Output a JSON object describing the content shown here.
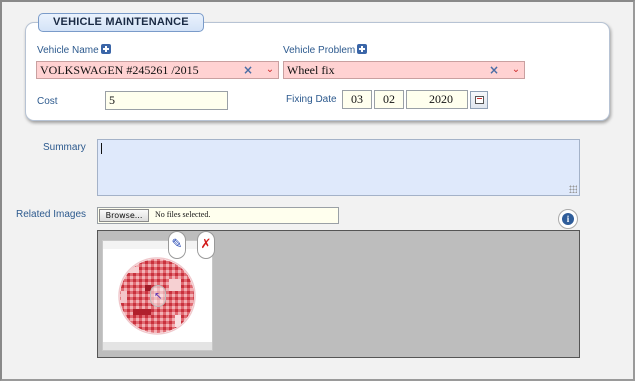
{
  "form": {
    "legend": "VEHICLE MAINTENANCE",
    "vehicle_name_label": "Vehicle Name",
    "vehicle_name_value": "VOLKSWAGEN #245261 /2015",
    "vehicle_problem_label": "Vehicle Problem",
    "vehicle_problem_value": "Wheel fix",
    "cost_label": "Cost",
    "cost_value": "5",
    "fixing_date_label": "Fixing Date",
    "fixing_date_day": "03",
    "fixing_date_month": "02",
    "fixing_date_year": "2020"
  },
  "summary": {
    "label": "Summary",
    "value": ""
  },
  "related_images": {
    "label": "Related Images",
    "browse_label": "Browse...",
    "no_files_text": "No files selected."
  },
  "icons": {
    "add": "plus-icon",
    "clear": "clear-x-icon",
    "dropdown": "chevron-down-icon",
    "calendar": "calendar-icon",
    "info": "info-icon",
    "edit": "pencil-icon",
    "delete": "delete-x-icon"
  },
  "glyphs": {
    "clear": "×",
    "dropdown": "⌄",
    "info": "i",
    "edit": "✎",
    "delete": "✗"
  },
  "colors": {
    "required_field_bg": "#ffd2d2",
    "input_bg": "#ffffee",
    "summary_bg": "#dfe9fb",
    "label": "#2d5a8e",
    "gallery_bg": "#bdbdbd"
  }
}
